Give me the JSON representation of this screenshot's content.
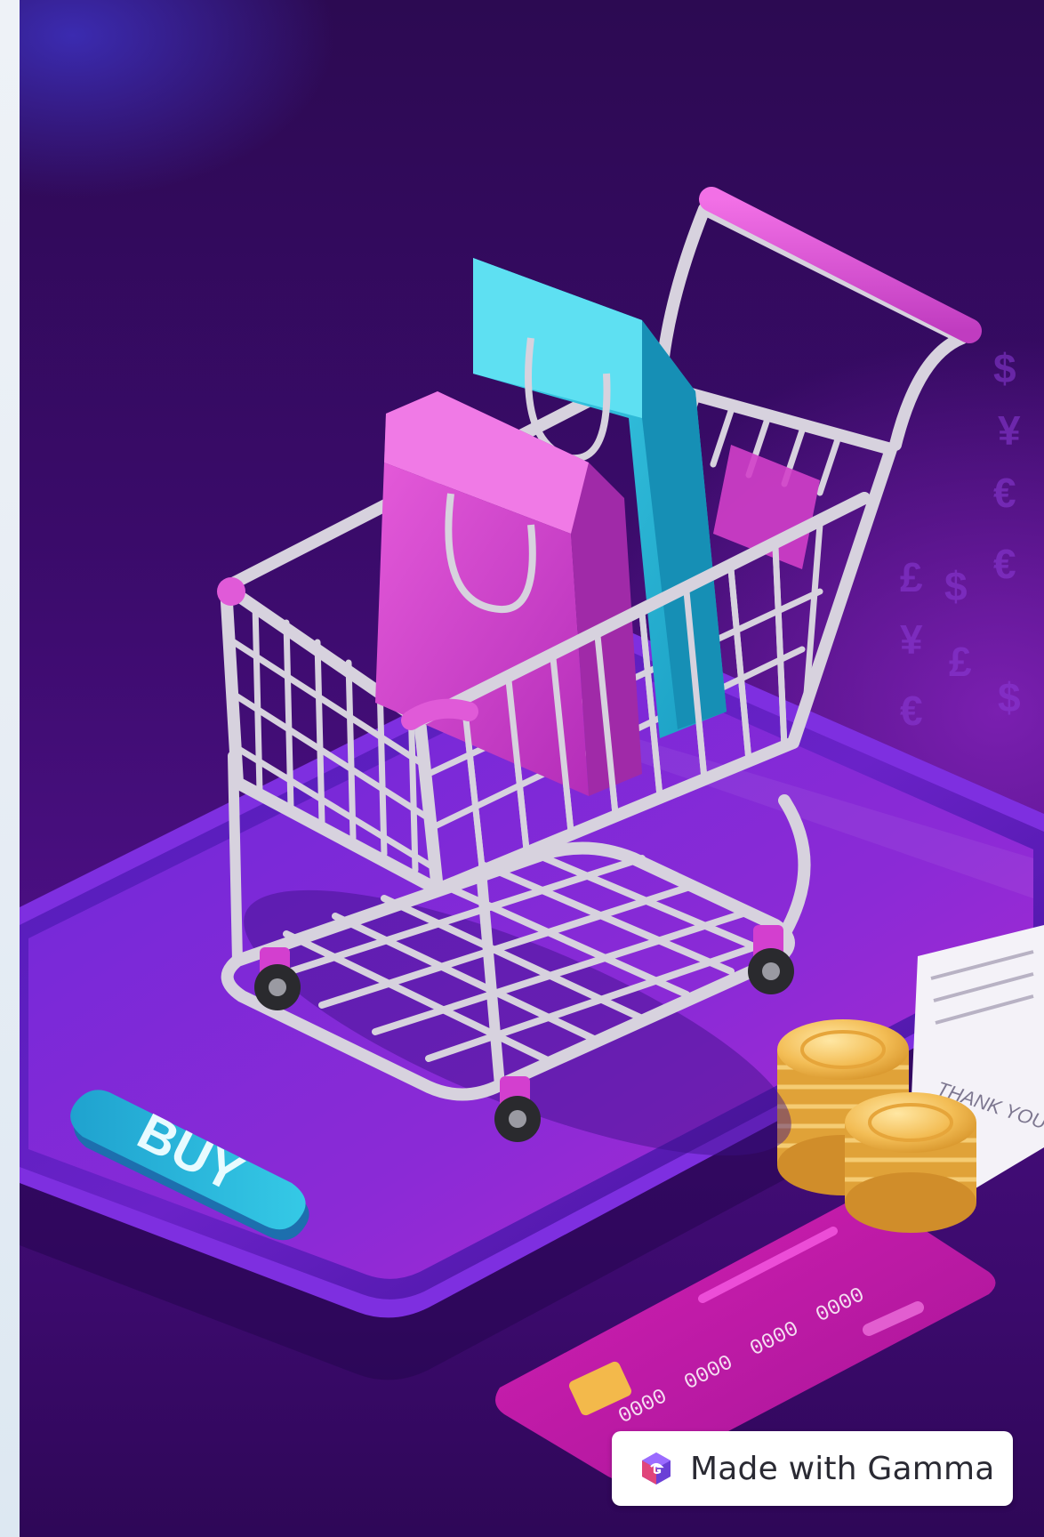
{
  "illustration": {
    "buy_button_label": "BUY",
    "currency_symbols": [
      "$",
      "¥",
      "€",
      "£",
      "$",
      "€",
      "¥",
      "£",
      "€",
      "$"
    ],
    "card_number_groups": [
      "0000",
      "0000",
      "0000",
      "0000"
    ],
    "receipt_text": "THANK YOU!",
    "colors": {
      "background": "#3a0b6a",
      "phone": "#5b1fc2",
      "buy_button": "#29b6d6",
      "bag_pink": "#d83fcf",
      "bag_cyan": "#2ec2e0",
      "cart_frame": "#d7d2de",
      "coins": "#f2b848",
      "card": "#c01aa6"
    }
  },
  "badge": {
    "label": "Made with Gamma",
    "logo_icon": "gamma-logo-icon"
  }
}
